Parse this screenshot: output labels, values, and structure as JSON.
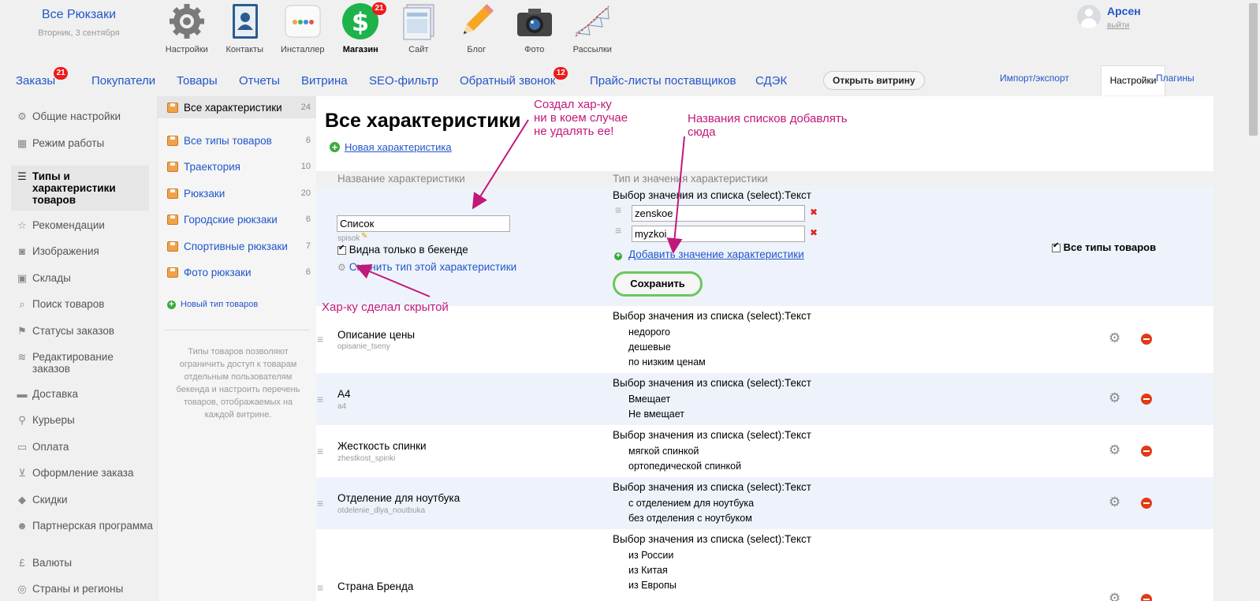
{
  "brand": {
    "name": "Все Рюкзаки",
    "date": "Вторник, 3 сентября"
  },
  "apps": [
    {
      "label": "Настройки",
      "icon": "gear-icon"
    },
    {
      "label": "Контакты",
      "icon": "contacts-icon"
    },
    {
      "label": "Инсталлер",
      "icon": "installer-icon"
    },
    {
      "label": "Магазин",
      "icon": "shop-icon",
      "badge": "21",
      "active": true
    },
    {
      "label": "Сайт",
      "icon": "site-icon"
    },
    {
      "label": "Блог",
      "icon": "pencil-icon"
    },
    {
      "label": "Фото",
      "icon": "camera-icon"
    },
    {
      "label": "Рассылки",
      "icon": "mailer-icon"
    }
  ],
  "user": {
    "name": "Арсен",
    "logout": "выйти"
  },
  "nav": {
    "items": [
      {
        "label": "Заказы",
        "badge": "21"
      },
      {
        "label": "Покупатели"
      },
      {
        "label": "Товары"
      },
      {
        "label": "Отчеты"
      },
      {
        "label": "Витрина"
      },
      {
        "label": "SEO-фильтр"
      },
      {
        "label": "Обратный звонок",
        "badge": "12"
      },
      {
        "label": "Прайс-листы поставщиков"
      },
      {
        "label": "СДЭК"
      }
    ],
    "open_storefront": "Открыть витрину",
    "right": {
      "import_export": "Импорт/экспорт",
      "settings": "Настройки",
      "plugins": "Плагины"
    }
  },
  "sidebar": {
    "items": [
      {
        "label": "Общие настройки",
        "icon": "gear-icon"
      },
      {
        "label": "Режим работы",
        "icon": "calendar-icon"
      },
      {
        "label": "Типы и характеристики товаров",
        "icon": "list-icon",
        "active": true
      },
      {
        "label": "Рекомендации",
        "icon": "star-icon"
      },
      {
        "label": "Изображения",
        "icon": "camera-icon"
      },
      {
        "label": "Склады",
        "icon": "box-icon"
      },
      {
        "label": "Поиск товаров",
        "icon": "search-icon"
      },
      {
        "label": "Статусы заказов",
        "icon": "flag-icon"
      },
      {
        "label": "Редактирование заказов",
        "icon": "layers-icon"
      },
      {
        "label": "Доставка",
        "icon": "truck-icon"
      },
      {
        "label": "Курьеры",
        "icon": "runner-icon"
      },
      {
        "label": "Оплата",
        "icon": "wallet-icon"
      },
      {
        "label": "Оформление заказа",
        "icon": "cart-icon"
      },
      {
        "label": "Скидки",
        "icon": "tag-icon"
      },
      {
        "label": "Партнерская программа",
        "icon": "person-icon"
      },
      {
        "label": "Валюты",
        "icon": "pound-icon"
      },
      {
        "label": "Страны и регионы",
        "icon": "globe-icon"
      }
    ]
  },
  "types": {
    "items": [
      {
        "label": "Все характеристики",
        "count": "24",
        "active": true
      },
      {
        "label": "Все типы товаров",
        "count": "6"
      },
      {
        "label": "Траектория",
        "count": "10"
      },
      {
        "label": "Рюкзаки",
        "count": "20"
      },
      {
        "label": "Городские рюкзаки",
        "count": "6"
      },
      {
        "label": "Спортивные рюкзаки",
        "count": "7"
      },
      {
        "label": "Фото рюкзаки",
        "count": "6"
      }
    ],
    "new_type": "Новый тип товаров",
    "help": "Типы товаров позволяют ограничить доступ к товарам отдельным пользователям бекенда и настроить перечень товаров, отображаемых на каждой витрине."
  },
  "content": {
    "title": "Все характеристики",
    "new_feature": "Новая характеристика",
    "col_name": "Название характеристики",
    "col_type": "Тип и значения характеристики",
    "edit": {
      "name_value": "Список",
      "code": "spisok",
      "backend_only": "Видна только в бекенде",
      "change_type": "Сменить тип этой характеристики",
      "type_label": "Выбор значения из списка (select):Текст",
      "values": [
        "zenskoe",
        "myzkoi"
      ],
      "add_value": "Добавить значение характеристики",
      "save": "Сохранить",
      "all_types": "Все типы товаров"
    },
    "rows": [
      {
        "name": "Описание цены",
        "code": "opisanie_tseny",
        "type": "Выбор значения из списка (select):Текст",
        "values": [
          "недорого",
          "дешевые",
          "по низким ценам"
        ]
      },
      {
        "name": "А4",
        "code": "a4",
        "type": "Выбор значения из списка (select):Текст",
        "values": [
          "Вмещает",
          "Не вмещает"
        ]
      },
      {
        "name": "Жесткость спинки",
        "code": "zhestkost_spinki",
        "type": "Выбор значения из списка (select):Текст",
        "values": [
          "мягкой спинкой",
          "ортопедической спинкой"
        ]
      },
      {
        "name": "Отделение для ноутбука",
        "code": "otdelenie_dlya_noutbuka",
        "type": "Выбор значения из списка (select):Текст",
        "values": [
          "с отделением для ноутбука",
          "без отделения с ноутбуком"
        ]
      },
      {
        "name": "Страна Бренда",
        "code": "",
        "type": "Выбор значения из списка (select):Текст",
        "values": [
          "из России",
          "из Китая",
          "из Европы"
        ]
      }
    ]
  },
  "annotations": {
    "a1": "Создал хар-ку\nни в коем случае\nне удалять ее!",
    "a2": "Названия списков добавлять\nсюда",
    "a3": "Хар-ку сделал скрытой"
  },
  "colors": {
    "link": "#2156c9",
    "badge": "#ef1a1a",
    "annotation": "#c2187a",
    "save_border": "#6ac75e",
    "row_alt": "#eef3fb"
  }
}
